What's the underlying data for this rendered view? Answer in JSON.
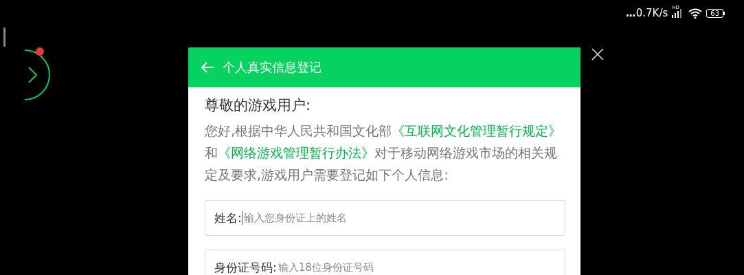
{
  "status_bar": {
    "notification_more": "...",
    "network_speed": "0.7K/s",
    "network_badge": "HD",
    "battery": "63"
  },
  "dialog": {
    "title": "个人真实信息登记",
    "greeting": "尊敬的游戏用户:",
    "intro": [
      {
        "kind": "plain",
        "text": "您好,根据中华人民共和国文化部"
      },
      {
        "kind": "link",
        "text": "《互联网文化管理暂行规定》"
      },
      {
        "kind": "plain",
        "text": "和"
      },
      {
        "kind": "link",
        "text": "《网络游戏管理暂行办法》"
      },
      {
        "kind": "plain",
        "text": "对于移动网络游戏市场的相关规定及要求,游戏用户需要登记如下个人信息:"
      }
    ],
    "fields": [
      {
        "label": "姓名:",
        "placeholder": "输入您身份证上的姓名",
        "focused": true
      },
      {
        "label": "身份证号码:",
        "placeholder": "输入18位身份证号码",
        "focused": false
      }
    ]
  }
}
